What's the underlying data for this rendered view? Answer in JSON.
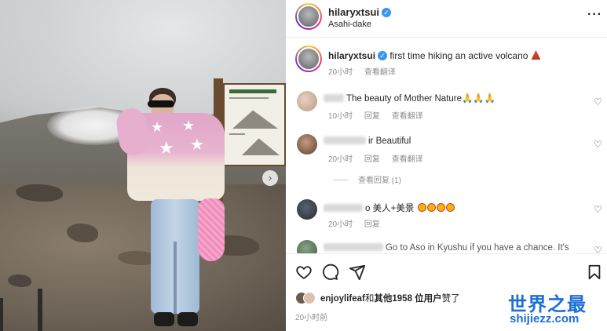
{
  "post": {
    "username": "hilaryxtsui",
    "location": "Asahi-dake",
    "caption": "first time hiking an active volcano",
    "caption_time": "20小时",
    "translate": "查看翻译"
  },
  "comments": [
    {
      "text": "The beauty of Mother Nature🙏🙏🙏",
      "time": "10小时",
      "reply": "回复",
      "translate": "查看翻译"
    },
    {
      "name_tail": "ir",
      "text": "Beautiful",
      "time": "20小时",
      "reply": "回复",
      "translate": "查看翻译"
    },
    {
      "name_tail": "o",
      "text": "美人+美景",
      "time": "20小时",
      "reply": "回复"
    },
    {
      "text": "Go to Aso in Kyushu if you have a chance. It's"
    }
  ],
  "view_replies": "查看回复 (1)",
  "likes": {
    "user": "enjoylifeaf",
    "and": "和",
    "others": "其他1958 位用户",
    "suffix": "赞了"
  },
  "posted_time": "20小时前",
  "watermark": {
    "title": "世界之最",
    "url": "shijiezz.com"
  },
  "icons": {
    "verified": "verified-badge-icon",
    "more": "more-options-icon",
    "like": "heart-icon",
    "comment": "comment-icon",
    "share": "share-icon",
    "save": "bookmark-icon",
    "next": "chevron-right-icon"
  },
  "colors": {
    "verified": "#3897f0",
    "watermark": "#1f6fd6",
    "muted": "#8e8e8e"
  }
}
